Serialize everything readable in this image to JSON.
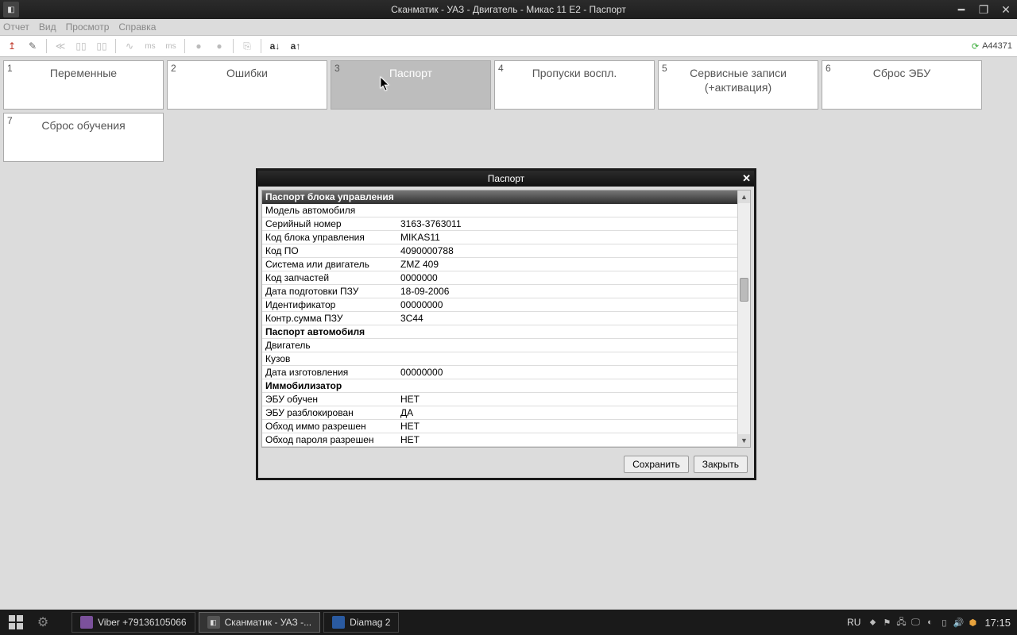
{
  "window": {
    "title": "Сканматик - УАЗ - Двигатель - Микас 11 Е2 - Паспорт"
  },
  "menu": {
    "items": [
      "Отчет",
      "Вид",
      "Просмотр",
      "Справка"
    ]
  },
  "toolbar": {
    "status_code": "A44371",
    "btn_asc": "a↓",
    "btn_desc": "a↑",
    "ms1": "ms",
    "ms2": "ms"
  },
  "tabs": [
    {
      "num": "1",
      "label": "Переменные"
    },
    {
      "num": "2",
      "label": "Ошибки"
    },
    {
      "num": "3",
      "label": "Паспорт",
      "active": true
    },
    {
      "num": "4",
      "label": "Пропуски воспл."
    },
    {
      "num": "5",
      "label": "Сервисные записи (+активация)"
    },
    {
      "num": "6",
      "label": "Сброс ЭБУ"
    },
    {
      "num": "7",
      "label": "Сброс обучения"
    }
  ],
  "modal": {
    "title": "Паспорт",
    "header": "Паспорт блока управления",
    "rows": [
      {
        "k": "Модель автомобиля",
        "v": ""
      },
      {
        "k": "Серийный номер",
        "v": "3163-3763011"
      },
      {
        "k": "Код блока управления",
        "v": "MIKAS11"
      },
      {
        "k": "Код ПО",
        "v": "4090000788"
      },
      {
        "k": "Система или двигатель",
        "v": "ZMZ 409"
      },
      {
        "k": "Код запчастей",
        "v": "0000000"
      },
      {
        "k": "Дата подготовки ПЗУ",
        "v": "18-09-2006"
      },
      {
        "k": "Идентификатор",
        "v": "00000000"
      },
      {
        "k": "Контр.сумма ПЗУ",
        "v": "3C44"
      }
    ],
    "section2": "Паспорт автомобиля",
    "rows2": [
      {
        "k": "Двигатель",
        "v": ""
      },
      {
        "k": "Кузов",
        "v": ""
      },
      {
        "k": "Дата изготовления",
        "v": "00000000"
      }
    ],
    "section3": "Иммобилизатор",
    "rows3": [
      {
        "k": "ЭБУ обучен",
        "v": "НЕТ"
      },
      {
        "k": "ЭБУ разблокирован",
        "v": "ДА"
      },
      {
        "k": "Обход иммо разрешен",
        "v": "НЕТ"
      },
      {
        "k": "Обход пароля разрешен",
        "v": "НЕТ"
      }
    ],
    "save_label": "Сохранить",
    "close_label": "Закрыть"
  },
  "taskbar": {
    "tasks": [
      {
        "label": "Viber +79136105066",
        "icon_color": "#7b519c"
      },
      {
        "label": "Сканматик - УАЗ -...",
        "icon_color": "#555",
        "active": true
      },
      {
        "label": "Diamag 2",
        "icon_color": "#2a5aa0"
      }
    ],
    "lang": "RU",
    "clock": "17:15"
  }
}
